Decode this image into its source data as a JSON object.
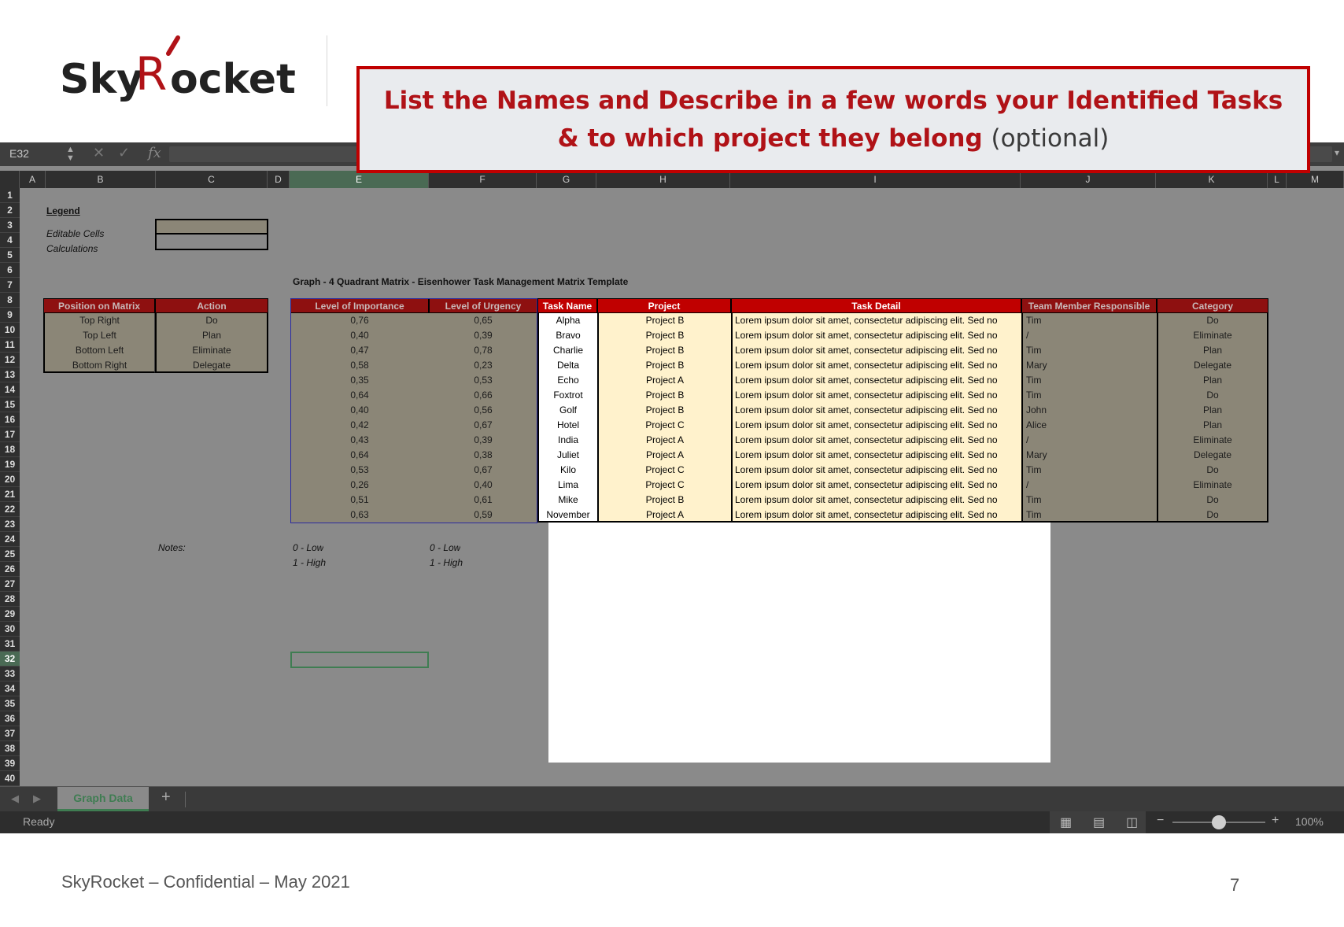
{
  "slide": {
    "callout_line1": "List the Names and Describe in a few words your Identified Tasks",
    "callout_line2_bold": "& to which project they belong",
    "callout_line2_optional": "(optional)",
    "footer": "SkyRocket – Confidential – May 2021",
    "page_number": "7",
    "logo_text": "SkyRocket"
  },
  "excel": {
    "name_box": "E32",
    "fx_label": "fx",
    "columns": [
      "A",
      "B",
      "C",
      "D",
      "E",
      "F",
      "G",
      "H",
      "I",
      "J",
      "K",
      "L",
      "M"
    ],
    "selected_column": "E",
    "selected_row": 32,
    "row_count": 40,
    "legend": {
      "title": "Legend",
      "editable_label": "Editable Cells",
      "calculations_label": "Calculations"
    },
    "graph_title": "Graph - 4 Quadrant Matrix  - Eisenhower Task Management Matrix Template",
    "position_table": {
      "headers": [
        "Position on Matrix",
        "Action"
      ],
      "rows": [
        [
          "Top Right",
          "Do"
        ],
        [
          "Top Left",
          "Plan"
        ],
        [
          "Bottom Left",
          "Eliminate"
        ],
        [
          "Bottom Right",
          "Delegate"
        ]
      ]
    },
    "task_table": {
      "headers": [
        "Level of Importance",
        "Level of Urgency",
        "Task Name",
        "Project",
        "Task Detail",
        "Team Member Responsible",
        "Category"
      ],
      "rows": [
        [
          "0,76",
          "0,65",
          "Alpha",
          "Project B",
          "Lorem ipsum dolor sit amet, consectetur adipiscing elit. Sed no",
          "Tim",
          "Do"
        ],
        [
          "0,40",
          "0,39",
          "Bravo",
          "Project B",
          "Lorem ipsum dolor sit amet, consectetur adipiscing elit. Sed no",
          "/",
          "Eliminate"
        ],
        [
          "0,47",
          "0,78",
          "Charlie",
          "Project B",
          "Lorem ipsum dolor sit amet, consectetur adipiscing elit. Sed no",
          "Tim",
          "Plan"
        ],
        [
          "0,58",
          "0,23",
          "Delta",
          "Project B",
          "Lorem ipsum dolor sit amet, consectetur adipiscing elit. Sed no",
          "Mary",
          "Delegate"
        ],
        [
          "0,35",
          "0,53",
          "Echo",
          "Project A",
          "Lorem ipsum dolor sit amet, consectetur adipiscing elit. Sed no",
          "Tim",
          "Plan"
        ],
        [
          "0,64",
          "0,66",
          "Foxtrot",
          "Project B",
          "Lorem ipsum dolor sit amet, consectetur adipiscing elit. Sed no",
          "Tim",
          "Do"
        ],
        [
          "0,40",
          "0,56",
          "Golf",
          "Project B",
          "Lorem ipsum dolor sit amet, consectetur adipiscing elit. Sed no",
          "John",
          "Plan"
        ],
        [
          "0,42",
          "0,67",
          "Hotel",
          "Project C",
          "Lorem ipsum dolor sit amet, consectetur adipiscing elit. Sed no",
          "Alice",
          "Plan"
        ],
        [
          "0,43",
          "0,39",
          "India",
          "Project A",
          "Lorem ipsum dolor sit amet, consectetur adipiscing elit. Sed no",
          "/",
          "Eliminate"
        ],
        [
          "0,64",
          "0,38",
          "Juliet",
          "Project A",
          "Lorem ipsum dolor sit amet, consectetur adipiscing elit. Sed no",
          "Mary",
          "Delegate"
        ],
        [
          "0,53",
          "0,67",
          "Kilo",
          "Project C",
          "Lorem ipsum dolor sit amet, consectetur adipiscing elit. Sed no",
          "Tim",
          "Do"
        ],
        [
          "0,26",
          "0,40",
          "Lima",
          "Project C",
          "Lorem ipsum dolor sit amet, consectetur adipiscing elit. Sed no",
          "/",
          "Eliminate"
        ],
        [
          "0,51",
          "0,61",
          "Mike",
          "Project B",
          "Lorem ipsum dolor sit amet, consectetur adipiscing elit. Sed no",
          "Tim",
          "Do"
        ],
        [
          "0,63",
          "0,59",
          "November",
          "Project A",
          "Lorem ipsum dolor sit amet, consectetur adipiscing elit. Sed no",
          "Tim",
          "Do"
        ]
      ]
    },
    "notes": {
      "label": "Notes:",
      "importance_low": "0 - Low",
      "importance_high": "1 - High",
      "urgency_low": "0 - Low",
      "urgency_high": "1 - High"
    },
    "sheet_tab": "Graph Data",
    "add_sheet": "+",
    "status": "Ready",
    "zoom": "100%",
    "zoom_minus": "−",
    "zoom_plus": "+"
  },
  "colors": {
    "accent_red": "#c00000",
    "dark_header_red": "#8e1010",
    "editable_tan": "#8b8677",
    "task_cream": "#fff2cc",
    "sheet_tab_green": "#3f7d52"
  }
}
